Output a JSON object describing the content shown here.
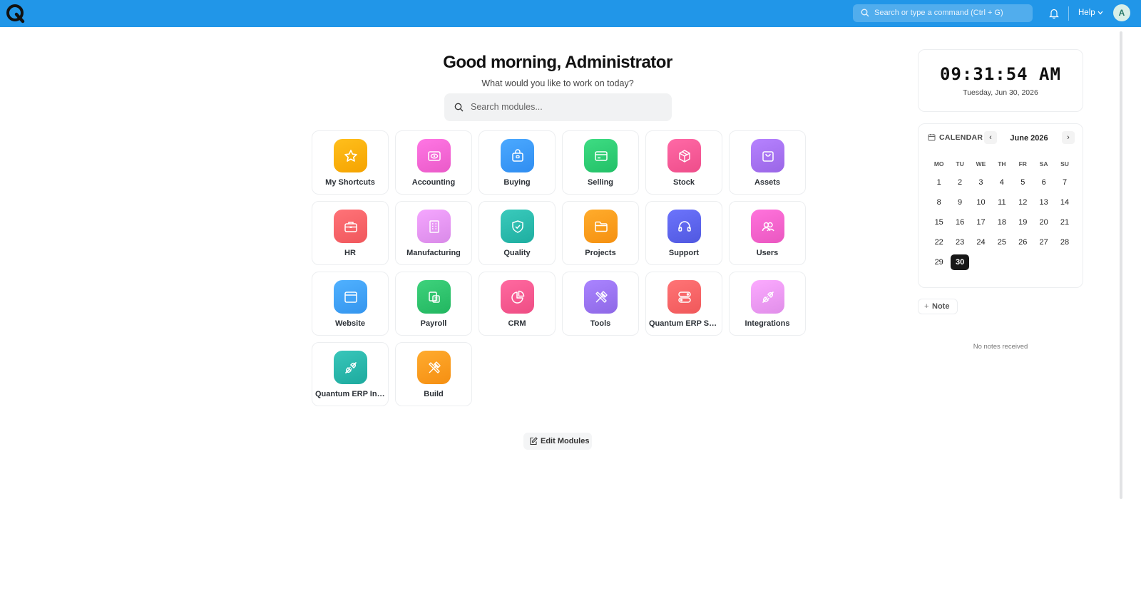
{
  "topbar": {
    "search_placeholder": "Search or type a command (Ctrl + G)",
    "help_label": "Help",
    "avatar_initial": "A",
    "brand_color": "#2196e8"
  },
  "greeting": {
    "title": "Good morning, Administrator",
    "subtitle": "What would you like to work on today?",
    "search_placeholder": "Search modules..."
  },
  "modules": [
    {
      "label": "My Shortcuts",
      "icon": "star-icon",
      "color": "#f5a300"
    },
    {
      "label": "Accounting",
      "icon": "eye-box-icon",
      "color": "#ea5ac8"
    },
    {
      "label": "Buying",
      "icon": "bag-icon",
      "color": "#2f8df1"
    },
    {
      "label": "Selling",
      "icon": "card-icon",
      "color": "#22c067"
    },
    {
      "label": "Stock",
      "icon": "box-icon",
      "color": "#ee4d8a"
    },
    {
      "label": "Assets",
      "icon": "basket-icon",
      "color": "#9a66e6"
    },
    {
      "label": "HR",
      "icon": "briefcase-icon",
      "color": "#f0575c"
    },
    {
      "label": "Manufacturing",
      "icon": "building-icon",
      "color": "#d98ae8"
    },
    {
      "label": "Quality",
      "icon": "shield-icon",
      "color": "#1eaea0"
    },
    {
      "label": "Projects",
      "icon": "folder-icon",
      "color": "#f59010"
    },
    {
      "label": "Support",
      "icon": "headset-icon",
      "color": "#5058e0"
    },
    {
      "label": "Users",
      "icon": "users-icon",
      "color": "#ea57c0"
    },
    {
      "label": "Website",
      "icon": "browser-icon",
      "color": "#3495ee"
    },
    {
      "label": "Payroll",
      "icon": "payroll-icon",
      "color": "#22b660"
    },
    {
      "label": "CRM",
      "icon": "pie-icon",
      "color": "#ee4d84"
    },
    {
      "label": "Tools",
      "icon": "tools-icon",
      "color": "#8e68e6"
    },
    {
      "label": "Quantum ERP Se...",
      "icon": "toggles-icon",
      "color": "#f0585a"
    },
    {
      "label": "Integrations",
      "icon": "plug-icon",
      "color": "#e08ee9"
    },
    {
      "label": "Quantum ERP Int...",
      "icon": "plug-icon",
      "color": "#1daa9e"
    },
    {
      "label": "Build",
      "icon": "tools-icon",
      "color": "#f58f12"
    }
  ],
  "edit_modules_label": "Edit Modules",
  "clock": {
    "time": "09:31:54 AM",
    "date": "Tuesday, Jun 30, 2026"
  },
  "calendar": {
    "heading": "CALENDAR",
    "month": "June 2026",
    "weekdays": [
      "MO",
      "TU",
      "WE",
      "TH",
      "FR",
      "SA",
      "SU"
    ],
    "days": [
      "1",
      "2",
      "3",
      "4",
      "5",
      "6",
      "7",
      "8",
      "9",
      "10",
      "11",
      "12",
      "13",
      "14",
      "15",
      "16",
      "17",
      "18",
      "19",
      "20",
      "21",
      "22",
      "23",
      "24",
      "25",
      "26",
      "27",
      "28",
      "29",
      "30"
    ],
    "today": "30"
  },
  "notes": {
    "add_label": "Note",
    "empty_text": "No notes received"
  }
}
